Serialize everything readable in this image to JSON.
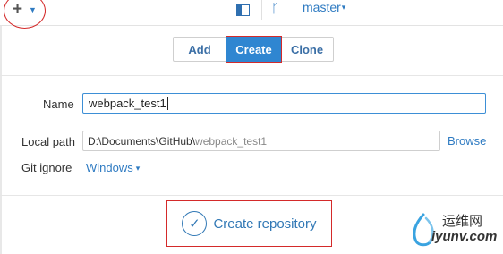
{
  "toolbar": {
    "add_menu_icon": "plus-icon",
    "add_menu_caret": "▼",
    "panel_icon": "panel-toggle-icon",
    "branch_icon_glyph": "ᚴ",
    "branch_name": "master",
    "branch_caret": "▾"
  },
  "mode_tabs": {
    "add": "Add",
    "create": "Create",
    "clone": "Clone",
    "active": "Create"
  },
  "form": {
    "name_label": "Name",
    "name_value": "webpack_test1",
    "local_path_label": "Local path",
    "local_path_dir": "D:\\Documents\\GitHub\\",
    "local_path_name": "webpack_test1",
    "browse_label": "Browse",
    "git_ignore_label": "Git ignore",
    "git_ignore_value": "Windows",
    "git_ignore_caret": "▾"
  },
  "actions": {
    "create_repository_label": "Create repository",
    "check_glyph": "✓"
  },
  "watermark": {
    "cn_text": "运维网",
    "en_text": "iyunv.com"
  },
  "colors": {
    "accent": "#2f86d1",
    "link": "#2f7bc2",
    "annotation_red": "#d42a2a"
  }
}
